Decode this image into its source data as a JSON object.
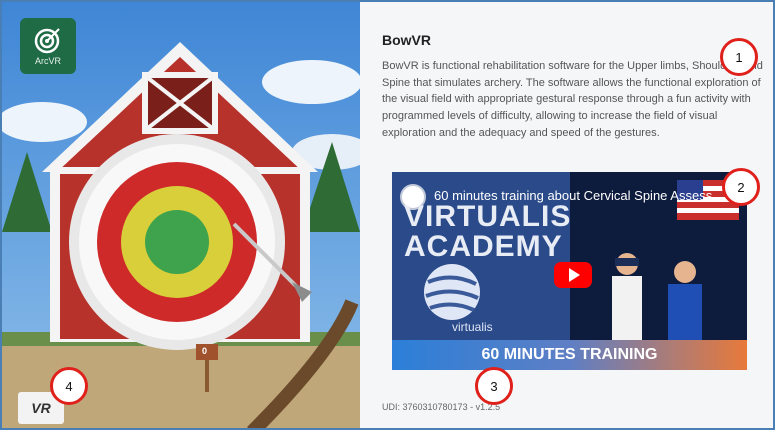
{
  "app": {
    "logo_label": "ArcVR",
    "title": "BowVR",
    "description": "BowVR is functional rehabilitation software for the Upper limbs, Shoulders and Spine that simulates archery. The software allows the functional exploration of the visual field with appropriate gestural response through a fun activity with programmed levels of difficulty, allowing to increase the field of visual exploration and the adequacy and speed of the gestures.",
    "udi": "UDI: 3760310780173 - v1.2.5",
    "vr_button_label": "VR",
    "target_sign": "0"
  },
  "video": {
    "title": "60 minutes training about Cervical Spine Assess...",
    "headline_1": "VIRTUALIS",
    "headline_2": "ACADEMY",
    "brand": "virtualis",
    "footer": "60 MINUTES TRAINING"
  },
  "markers": [
    "1",
    "2",
    "3",
    "4"
  ],
  "colors": {
    "accent_green": "#1f6b45",
    "marker_red": "#e0201a",
    "frame_blue": "#4a7fb5",
    "barn_red": "#b8322c",
    "youtube_red": "#ff0000"
  },
  "icons": [
    "target-icon",
    "play-icon"
  ]
}
